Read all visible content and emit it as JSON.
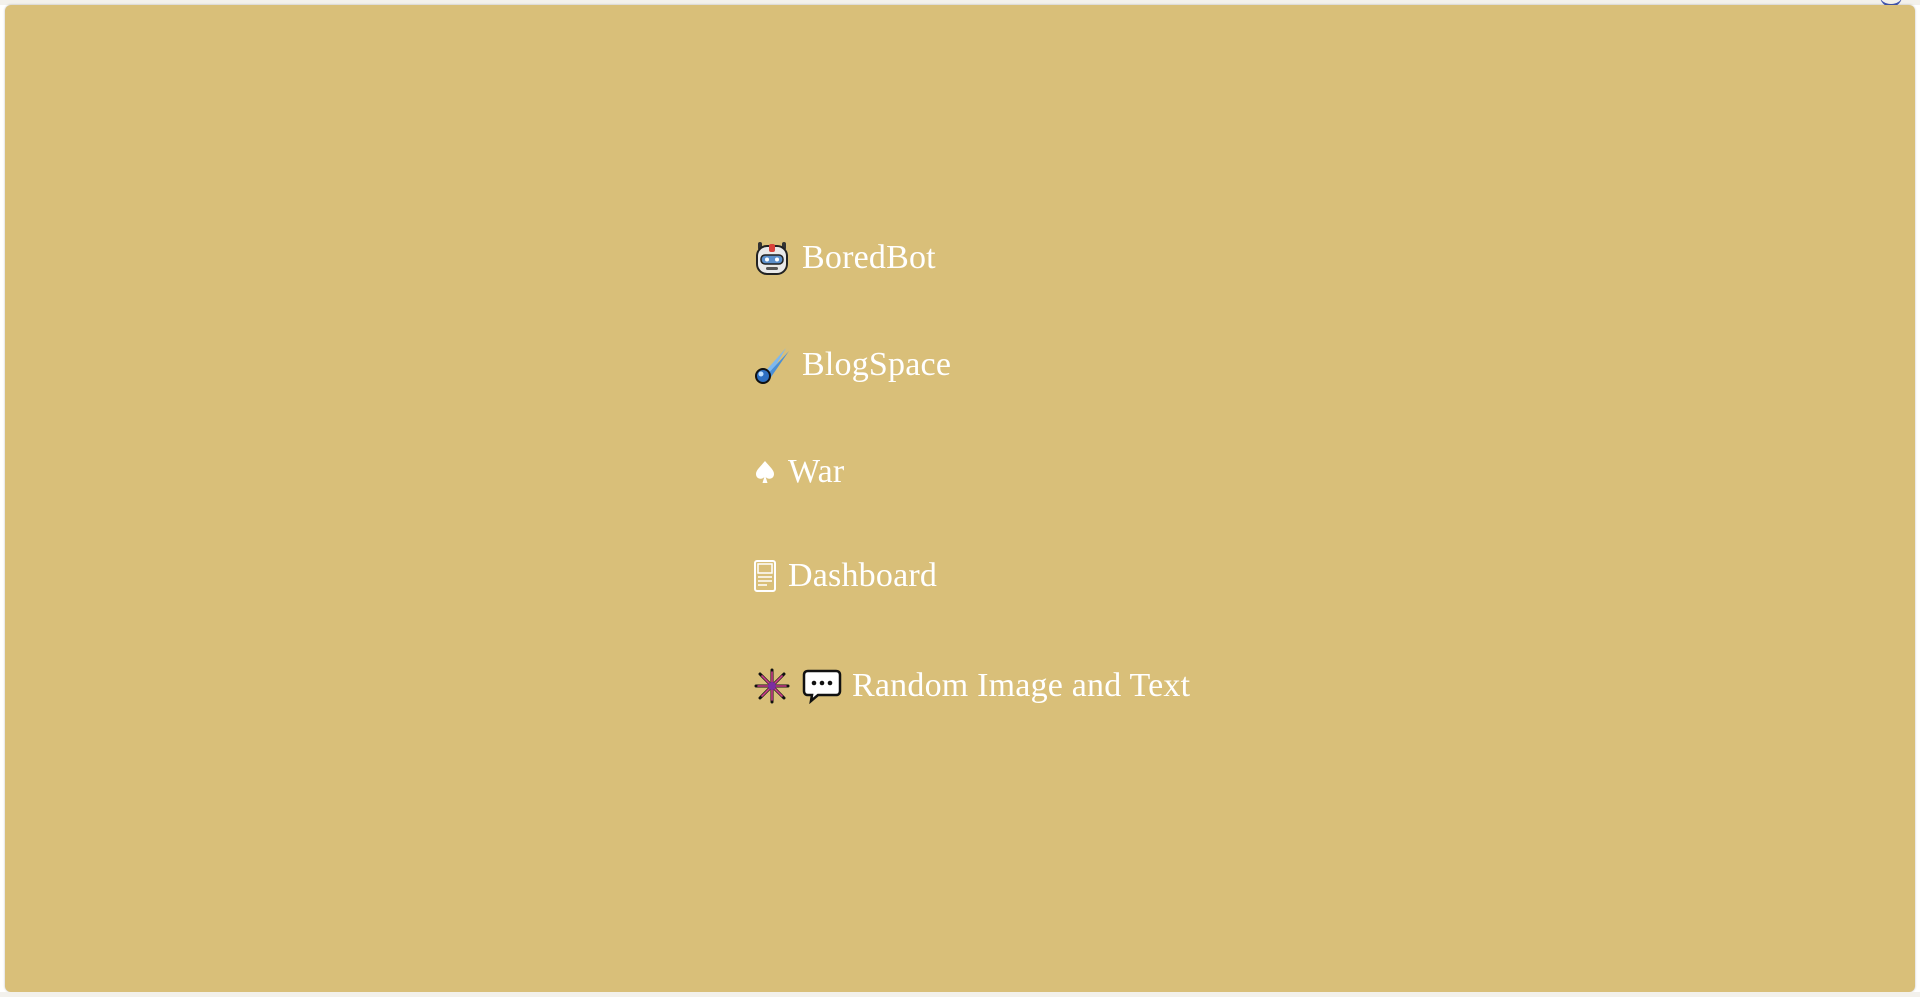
{
  "nav": {
    "items": [
      {
        "label": "BoredBot",
        "icon": "robot-icon"
      },
      {
        "label": "BlogSpace",
        "icon": "comet-icon"
      },
      {
        "label": "War",
        "icon": "spade-icon"
      },
      {
        "label": "Dashboard",
        "icon": "pager-icon"
      },
      {
        "label": "Random Image and Text",
        "icons": [
          "fireworks-icon",
          "speech-bubble-icon"
        ]
      }
    ]
  },
  "colors": {
    "background": "#d9bf79",
    "text": "#ffffff"
  }
}
